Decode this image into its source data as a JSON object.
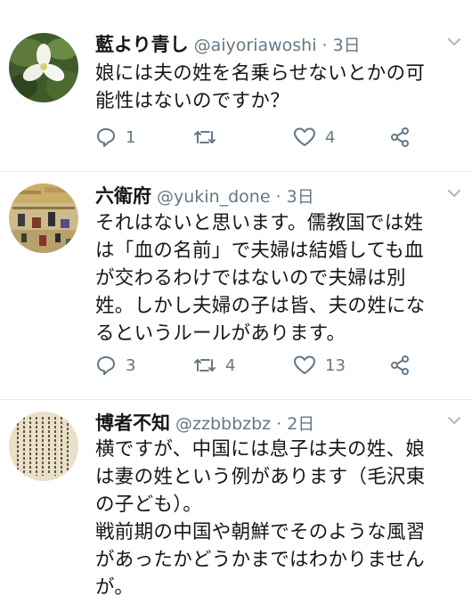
{
  "tweets": [
    {
      "name": "藍より青し",
      "handle": "@aiyoriawoshi",
      "time": "· 3日",
      "text": "娘には夫の姓を名乗らせないとかの可\n能性はないのですか？",
      "replies": "1",
      "retweets": "",
      "likes": "4",
      "avatar": "flower"
    },
    {
      "name": "六衛府",
      "handle": "@yukin_done",
      "time": "· 3日",
      "text": "それはないと思います。儒教国では姓\nは「血の名前」で夫婦は結婚しても血\nが交わるわけではないので夫婦は別\n姓。しかし夫婦の子は皆、夫の姓にな\nるというルールがあります。",
      "replies": "3",
      "retweets": "4",
      "likes": "13",
      "avatar": "painting"
    },
    {
      "name": "博者不知",
      "handle": "@zzbbbzbz",
      "time": "· 2日",
      "text": "横ですが、中国には息子は夫の姓、娘\nは妻の姓という例があります（毛沢東\nの子ども）。\n戦前期の中国や朝鮮でそのような風習\nがあったかどうかまではわかりません\nが。",
      "avatar": "manuscript"
    }
  ],
  "icons": {
    "reply": "reply-icon",
    "retweet": "retweet-icon",
    "like": "heart-icon",
    "share": "share-icon",
    "caret": "chevron-down-icon"
  },
  "colors": {
    "text": "#14171a",
    "secondary": "#657786",
    "divider": "#e6ecf0"
  }
}
